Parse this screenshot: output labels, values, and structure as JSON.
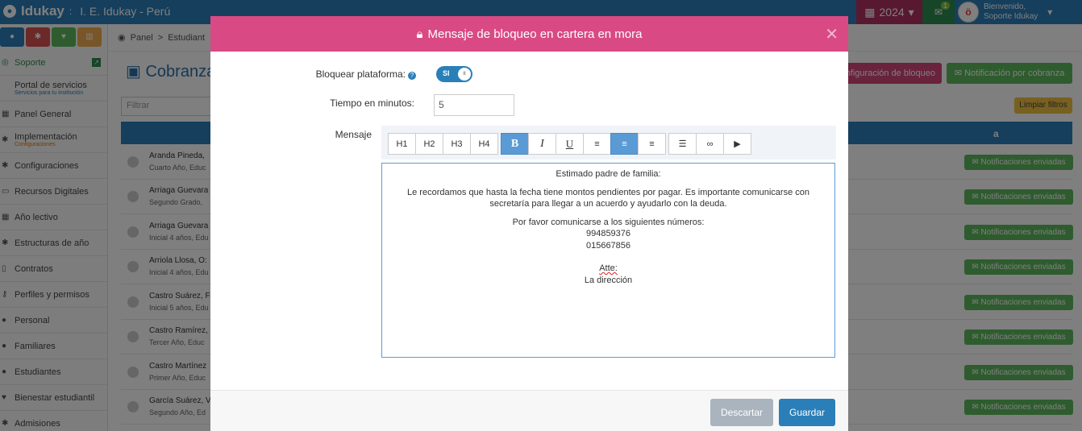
{
  "topbar": {
    "brand": "Idukay",
    "separator": ":",
    "institution": "I. E. Idukay - Perú",
    "year": "2024",
    "mail_count": "1",
    "welcome": "Bienvenido,",
    "user_name": "Soporte Idukay"
  },
  "sidebar": {
    "items": [
      {
        "label": "Soporte"
      },
      {
        "label": "Portal de servicios",
        "sub": "Servicios para tu institución"
      },
      {
        "label": "Panel General"
      },
      {
        "label": "Implementación",
        "sub": "Configuraciones"
      },
      {
        "label": "Configuraciones"
      },
      {
        "label": "Recursos Digitales"
      },
      {
        "label": "Año lectivo"
      },
      {
        "label": "Estructuras de año"
      },
      {
        "label": "Contratos"
      },
      {
        "label": "Perfiles y permisos"
      },
      {
        "label": "Personal"
      },
      {
        "label": "Familiares"
      },
      {
        "label": "Estudiantes"
      },
      {
        "label": "Bienestar estudiantil"
      },
      {
        "label": "Admisiones"
      }
    ]
  },
  "breadcrumb": {
    "panel": "Panel",
    "sep": ">",
    "current": "Estudiant"
  },
  "page": {
    "title": "Cobranza",
    "config_button": "nfiguración de bloqueo",
    "notif_button": "Notificación por cobranza",
    "filter_placeholder": "Filtrar",
    "clear_filters": "Limpiar filtros",
    "table_head_fragment": "a"
  },
  "rows": [
    {
      "name": "Aranda Pineda, ",
      "sub": "Cuarto Año, Educ",
      "status": "Notificaciones enviadas"
    },
    {
      "name": "Arriaga Guevara",
      "sub": "Segundo Grado, ",
      "status": "Notificaciones enviadas"
    },
    {
      "name": "Arriaga Guevara",
      "sub": "Inicial 4 años, Edu",
      "status": "Notificaciones enviadas"
    },
    {
      "name": "Arriola Llosa, O:",
      "sub": "Inicial 4 años, Edu",
      "status": "Notificaciones enviadas"
    },
    {
      "name": "Castro Suárez, F",
      "sub": "Inicial 5 años, Edu",
      "status": "Notificaciones enviadas"
    },
    {
      "name": "Castro Ramírez, ",
      "sub": "Tercer Año, Educ",
      "status": "Notificaciones enviadas"
    },
    {
      "name": "Castro Martínez",
      "sub": "Primer Año, Educ",
      "status": "Notificaciones enviadas"
    },
    {
      "name": "García Suárez, V",
      "sub": "Segundo Año, Ed",
      "status": "Notificaciones enviadas"
    }
  ],
  "modal": {
    "title": "Mensaje de bloqueo en cartera en mora",
    "block_label": "Bloquear plataforma:",
    "toggle_value": "SI",
    "minutes_label": "Tiempo en minutos:",
    "minutes_value": "5",
    "message_label": "Mensaje",
    "toolbar": {
      "h1": "H1",
      "h2": "H2",
      "h3": "H3",
      "h4": "H4",
      "bold": "B",
      "italic": "I",
      "underline": "U"
    },
    "message": {
      "greeting": "Estimado padre de familia:",
      "line1": "Le recordamos que hasta la fecha tiene montos pendientes por pagar. Es importante comunicarse con",
      "line2": "secretaría para llegar a un acuerdo y ayudarlo con la deuda.",
      "contact": "Por favor comunicarse a los siguientes números:",
      "phone1": "994859376",
      "phone2": "015667856",
      "sign1": "Atte:",
      "sign2": "La dirección"
    },
    "discard": "Descartar",
    "save": "Guardar"
  }
}
